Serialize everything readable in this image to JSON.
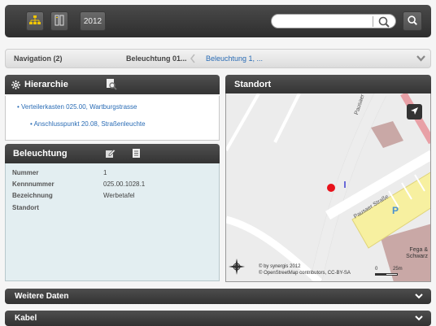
{
  "toolbar": {
    "year_button": "2012",
    "search_placeholder": ""
  },
  "navigation": {
    "label": "Navigation (2)",
    "crumb_1": "Beleuchtung 01...",
    "crumb_2": "Beleuchtung 1, ..."
  },
  "hierarchie": {
    "title": "Hierarchie",
    "items": [
      "Verteilerkasten 025.00, Wartburgstrasse",
      "Anschlusspunkt 20.08, Straßenleuchte"
    ]
  },
  "beleuchtung": {
    "title": "Beleuchtung",
    "fields": [
      {
        "label": "Nummer",
        "value": "1"
      },
      {
        "label": "Kennnummer",
        "value": "025.00.1028.1"
      },
      {
        "label": "Bezeichnung",
        "value": "Werbetafel"
      },
      {
        "label": "Standort",
        "value": ""
      }
    ]
  },
  "standort": {
    "title": "Standort",
    "street_1": "Pausaer Straße",
    "street_2": "Pausaer Straße",
    "poi": "Fega & Schwarz",
    "parking": "P",
    "attribution_1": "© by synergis 2012",
    "attribution_2": "© OpenStreetMap contributors, CC-BY-SA",
    "scale_0": "0",
    "scale_25": "25m"
  },
  "sections": {
    "weitere_daten": "Weitere Daten",
    "kabel": "Kabel"
  },
  "colors": {
    "link": "#2a6cb5",
    "marker": "#e8121b"
  }
}
